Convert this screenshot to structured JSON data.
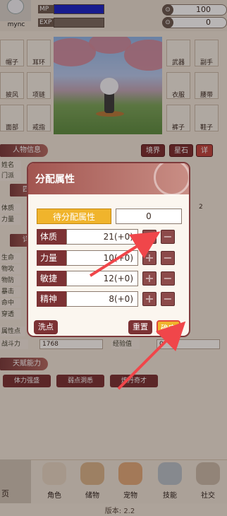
{
  "top": {
    "username": "mync",
    "mp_label": "MP",
    "exp_label": "EXP",
    "currency1": "100",
    "currency2": "0"
  },
  "equipment": {
    "left": [
      "帽子",
      "耳环",
      "披风",
      "项链",
      "面部",
      "戒指"
    ],
    "right": [
      "武器",
      "副手",
      "衣服",
      "腰带",
      "裤子",
      "鞋子"
    ]
  },
  "info": {
    "section_person": "人物信息",
    "btn_realm": "境界",
    "btn_gem": "星石",
    "btn_extra": "详",
    "rows_top": [
      "姓名",
      "门派"
    ],
    "section_four": "四",
    "rows_mid": [
      "体质",
      "力量"
    ],
    "mid_value_right": "2",
    "section_detail": "详",
    "rows_detail": [
      "生命",
      "物攻",
      "物防",
      "暴击",
      "命中",
      "穿透",
      "属性点"
    ],
    "combat_label": "战斗力",
    "combat_value": "1768",
    "exp_label": "经验值",
    "exp_value": "0",
    "section_talent": "天赋能力",
    "talents": [
      "体力强盛",
      "弱点洞悉",
      "炼丹奇才"
    ]
  },
  "nav": {
    "left_tab": "页",
    "items": [
      "角色",
      "储物",
      "宠物",
      "技能",
      "社交"
    ],
    "version": "版本: 2.2"
  },
  "dialog": {
    "title": "分配属性",
    "pending_label": "待分配属性",
    "pending_value": "0",
    "attributes": [
      {
        "label": "体质",
        "value": "21(+0)"
      },
      {
        "label": "力量",
        "value": "10(+0)"
      },
      {
        "label": "敏捷",
        "value": "12(+0)"
      },
      {
        "label": "精神",
        "value": "8(+0)"
      }
    ],
    "plus": "+",
    "minus": "−",
    "wash_label": "洗点",
    "reset_label": "重置",
    "confirm_label": "确定"
  },
  "colors": {
    "accent": "#7c3234",
    "highlight": "#f0b42c",
    "arrow": "#f0464a"
  }
}
